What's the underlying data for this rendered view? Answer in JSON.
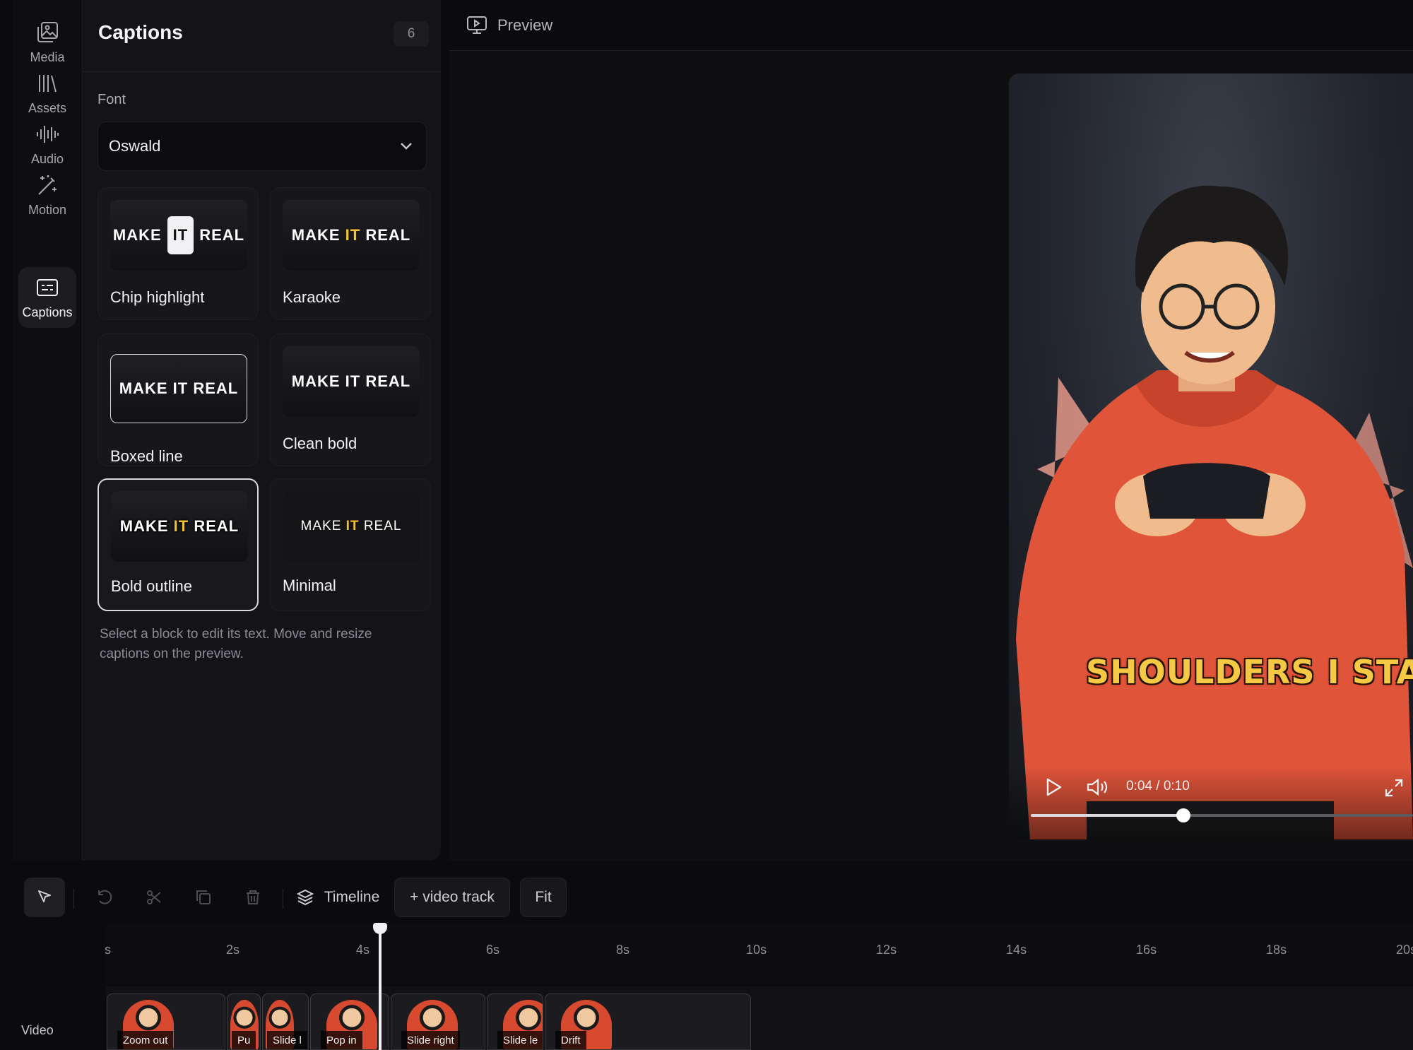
{
  "rail": {
    "items": [
      {
        "label": "Media",
        "icon": "media-icon"
      },
      {
        "label": "Assets",
        "icon": "assets-icon"
      },
      {
        "label": "Audio",
        "icon": "audio-icon"
      },
      {
        "label": "Motion",
        "icon": "motion-icon"
      },
      {
        "label": "Captions",
        "icon": "captions-icon",
        "active": true
      }
    ]
  },
  "panel": {
    "title": "Captions",
    "count": "6",
    "font_label": "Font",
    "font_value": "Oswald",
    "styles": [
      {
        "name": "Chip highlight",
        "w1": "MAKE",
        "w2": "IT",
        "w3": "REAL"
      },
      {
        "name": "Karaoke",
        "w1": "MAKE",
        "w2": "IT",
        "w3": "REAL"
      },
      {
        "name": "Boxed line",
        "text": "MAKE IT REAL"
      },
      {
        "name": "Clean bold",
        "text": "MAKE IT REAL"
      },
      {
        "name": "Bold outline",
        "w1": "MAKE",
        "w2": "IT",
        "w3": "REAL",
        "selected": true
      },
      {
        "name": "Minimal",
        "w1": "MAKE",
        "w2": "IT",
        "w3": "REAL"
      }
    ],
    "hint": "Select a block to edit its text. Move and resize captions on the preview."
  },
  "preview": {
    "title": "Preview",
    "caption_left": "SHOULDERS",
    "caption_mid": "I",
    "caption_right": "STAND",
    "time": "0:04 / 0:10",
    "progress": 0.4
  },
  "toolbar": {
    "timeline_label": "Timeline",
    "add_track_label": "+ video track",
    "fit_label": "Fit"
  },
  "timeline": {
    "ticks": [
      "s",
      "2s",
      "4s",
      "6s",
      "8s",
      "10s",
      "12s",
      "14s",
      "16s",
      "18s",
      "20s"
    ],
    "track_label": "Video",
    "clips": [
      "Zoom out",
      "Pu",
      "Slide l",
      "Pop in",
      "Slide right",
      "Slide le",
      "Drift"
    ]
  },
  "colors": {
    "accent_yellow": "#f2c230",
    "background": "#0b0b0d",
    "panel": "#141418"
  }
}
